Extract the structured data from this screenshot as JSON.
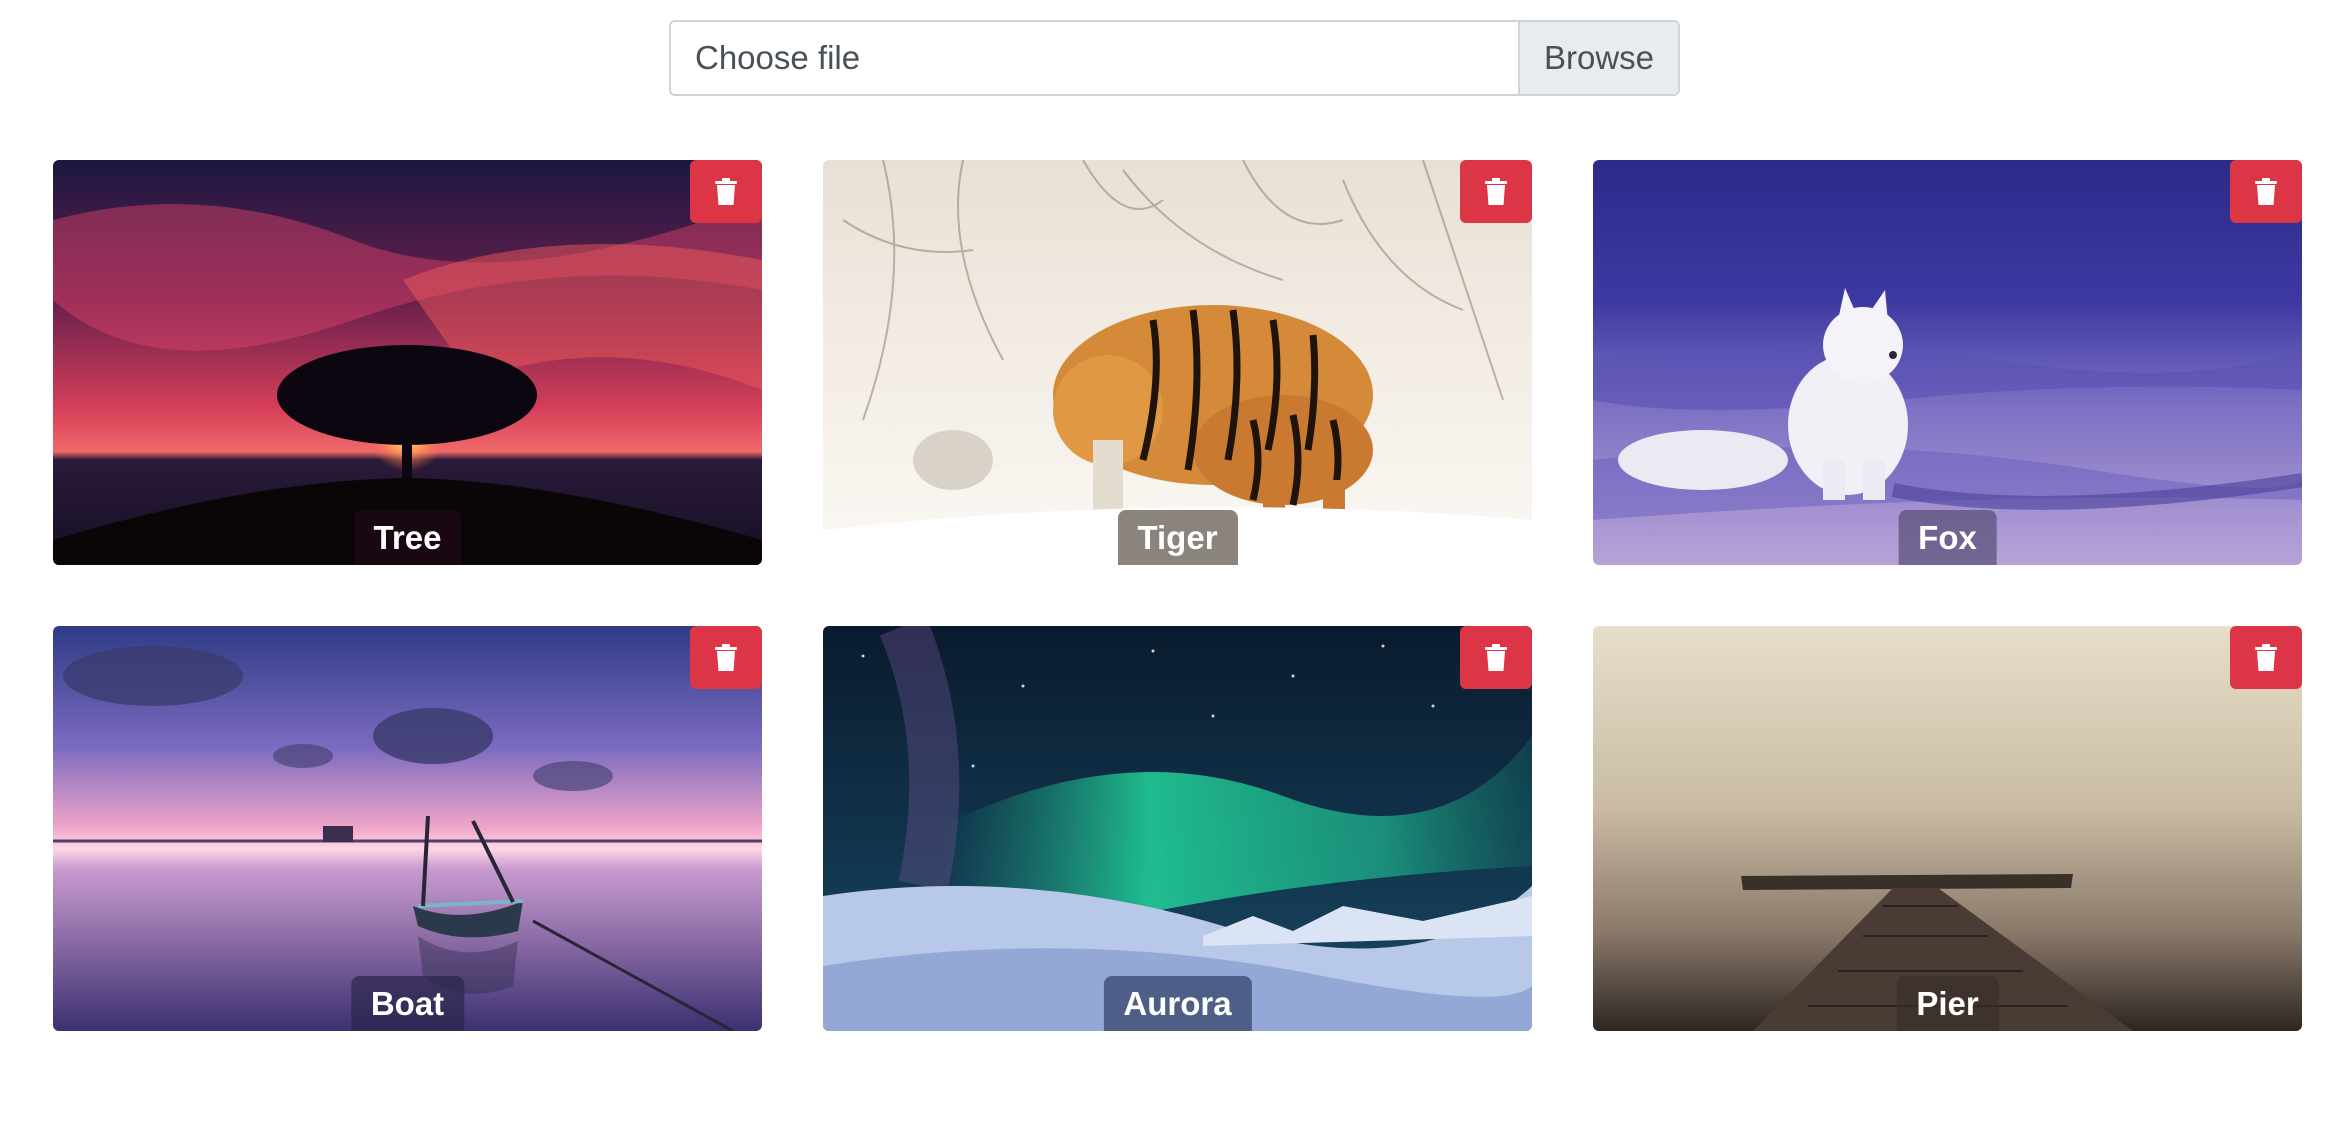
{
  "upload": {
    "placeholder": "Choose file",
    "button_label": "Browse"
  },
  "gallery": {
    "items": [
      {
        "caption": "Tree"
      },
      {
        "caption": "Tiger"
      },
      {
        "caption": "Fox"
      },
      {
        "caption": "Boat"
      },
      {
        "caption": "Aurora"
      },
      {
        "caption": "Pier"
      }
    ]
  },
  "icons": {
    "delete": "trash-icon"
  },
  "colors": {
    "delete_button": "#dc3545",
    "input_border": "#ced4da",
    "browse_bg": "#e9ecef"
  }
}
